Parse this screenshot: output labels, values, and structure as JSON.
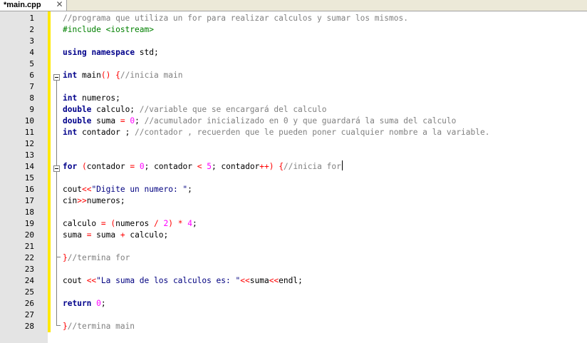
{
  "tab": {
    "title": "*main.cpp",
    "close_glyph": "✕"
  },
  "lines": [
    {
      "n": "1",
      "tokens": [
        {
          "t": "//programa que utiliza un for para realizar calculos y sumar los mismos.",
          "c": "cm"
        }
      ]
    },
    {
      "n": "2",
      "tokens": [
        {
          "t": "#include <iostream>",
          "c": "pp"
        }
      ]
    },
    {
      "n": "3",
      "tokens": []
    },
    {
      "n": "4",
      "tokens": [
        {
          "t": "using",
          "c": "kw"
        },
        {
          "t": " "
        },
        {
          "t": "namespace",
          "c": "kw"
        },
        {
          "t": " std;"
        }
      ]
    },
    {
      "n": "5",
      "tokens": []
    },
    {
      "n": "6",
      "tokens": [
        {
          "t": "int",
          "c": "kw"
        },
        {
          "t": " main"
        },
        {
          "t": "()",
          "c": "op"
        },
        {
          "t": " "
        },
        {
          "t": "{",
          "c": "op"
        },
        {
          "t": "//inicia main",
          "c": "cm"
        }
      ]
    },
    {
      "n": "7",
      "tokens": []
    },
    {
      "n": "8",
      "tokens": [
        {
          "t": "int",
          "c": "kw"
        },
        {
          "t": " numeros;"
        }
      ]
    },
    {
      "n": "9",
      "tokens": [
        {
          "t": "double",
          "c": "kw"
        },
        {
          "t": " calculo; "
        },
        {
          "t": "//variable que se encargará del calculo",
          "c": "cm"
        }
      ]
    },
    {
      "n": "10",
      "tokens": [
        {
          "t": "double",
          "c": "kw"
        },
        {
          "t": " suma "
        },
        {
          "t": "=",
          "c": "op"
        },
        {
          "t": " "
        },
        {
          "t": "0",
          "c": "nm"
        },
        {
          "t": "; "
        },
        {
          "t": "//acumulador inicializado en 0 y que guardará la suma del calculo",
          "c": "cm"
        }
      ]
    },
    {
      "n": "11",
      "tokens": [
        {
          "t": "int",
          "c": "kw"
        },
        {
          "t": " contador ; "
        },
        {
          "t": "//contador , recuerden que le pueden poner cualquier nombre a la variable.",
          "c": "cm"
        }
      ]
    },
    {
      "n": "12",
      "tokens": []
    },
    {
      "n": "13",
      "tokens": []
    },
    {
      "n": "14",
      "tokens": [
        {
          "t": "for",
          "c": "kw"
        },
        {
          "t": " "
        },
        {
          "t": "(",
          "c": "op"
        },
        {
          "t": "contador "
        },
        {
          "t": "=",
          "c": "op"
        },
        {
          "t": " "
        },
        {
          "t": "0",
          "c": "nm"
        },
        {
          "t": "; contador "
        },
        {
          "t": "<",
          "c": "op"
        },
        {
          "t": " "
        },
        {
          "t": "5",
          "c": "nm"
        },
        {
          "t": "; contador"
        },
        {
          "t": "++)",
          "c": "op"
        },
        {
          "t": " "
        },
        {
          "t": "{",
          "c": "op"
        },
        {
          "t": "//inicia for",
          "c": "cm"
        }
      ]
    },
    {
      "n": "15",
      "tokens": []
    },
    {
      "n": "16",
      "tokens": [
        {
          "t": "cout"
        },
        {
          "t": "<<",
          "c": "op"
        },
        {
          "t": "\"Digite un numero: \"",
          "c": "st"
        },
        {
          "t": ";"
        }
      ]
    },
    {
      "n": "17",
      "tokens": [
        {
          "t": "cin"
        },
        {
          "t": ">>",
          "c": "op"
        },
        {
          "t": "numeros;"
        }
      ]
    },
    {
      "n": "18",
      "tokens": []
    },
    {
      "n": "19",
      "tokens": [
        {
          "t": "calculo "
        },
        {
          "t": "=",
          "c": "op"
        },
        {
          "t": " "
        },
        {
          "t": "(",
          "c": "op"
        },
        {
          "t": "numeros "
        },
        {
          "t": "/",
          "c": "op"
        },
        {
          "t": " "
        },
        {
          "t": "2",
          "c": "nm"
        },
        {
          "t": ")",
          "c": "op"
        },
        {
          "t": " "
        },
        {
          "t": "*",
          "c": "op"
        },
        {
          "t": " "
        },
        {
          "t": "4",
          "c": "nm"
        },
        {
          "t": ";"
        }
      ]
    },
    {
      "n": "20",
      "tokens": [
        {
          "t": "suma "
        },
        {
          "t": "=",
          "c": "op"
        },
        {
          "t": " suma "
        },
        {
          "t": "+",
          "c": "op"
        },
        {
          "t": " calculo;"
        }
      ]
    },
    {
      "n": "21",
      "tokens": []
    },
    {
      "n": "22",
      "tokens": [
        {
          "t": "}",
          "c": "op"
        },
        {
          "t": "//termina for",
          "c": "cm"
        }
      ]
    },
    {
      "n": "23",
      "tokens": []
    },
    {
      "n": "24",
      "tokens": [
        {
          "t": "cout "
        },
        {
          "t": "<<",
          "c": "op"
        },
        {
          "t": "\"La suma de los calculos es: \"",
          "c": "st"
        },
        {
          "t": "<<",
          "c": "op"
        },
        {
          "t": "suma"
        },
        {
          "t": "<<",
          "c": "op"
        },
        {
          "t": "endl;"
        }
      ]
    },
    {
      "n": "25",
      "tokens": []
    },
    {
      "n": "26",
      "tokens": [
        {
          "t": "return",
          "c": "kw"
        },
        {
          "t": " "
        },
        {
          "t": "0",
          "c": "nm"
        },
        {
          "t": ";"
        }
      ]
    },
    {
      "n": "27",
      "tokens": []
    },
    {
      "n": "28",
      "tokens": [
        {
          "t": "}",
          "c": "op"
        },
        {
          "t": "//termina main",
          "c": "cm"
        }
      ]
    }
  ],
  "colors": {
    "keyword": "#00008b",
    "comment": "#808080",
    "preprocessor": "#008000",
    "string": "#000080",
    "number": "#ff00ff",
    "operator": "#ff0000",
    "gutter": "#e4e4e4",
    "change_bar": "#ffe800"
  },
  "icons": [
    "close-icon",
    "fold-minus-icon"
  ]
}
